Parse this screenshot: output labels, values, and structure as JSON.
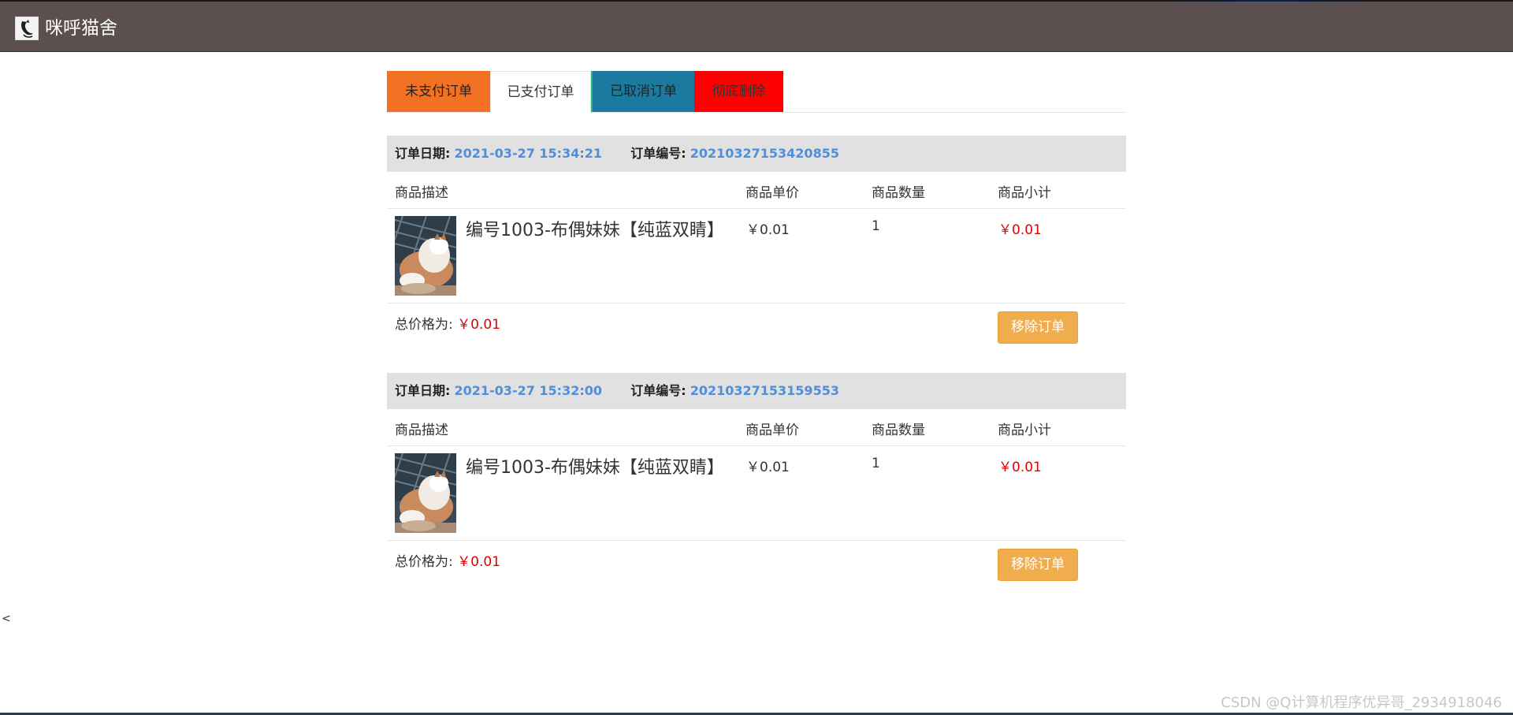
{
  "header": {
    "app_title": "咪呼猫舍",
    "logo_icon": "cat-logo-icon"
  },
  "tabs": [
    {
      "label": "未支付订单",
      "color": "#f37123"
    },
    {
      "label": "已支付订单",
      "color": "#ffffff",
      "active": true
    },
    {
      "label": "已取消订单",
      "color": "#1a7aa0"
    },
    {
      "label": "彻底删除",
      "color": "#ff0000"
    }
  ],
  "columns": {
    "desc": "商品描述",
    "unit_price": "商品单价",
    "quantity": "商品数量",
    "subtotal": "商品小计"
  },
  "labels": {
    "order_date": "订单日期:",
    "order_no": "订单编号:",
    "total": "总价格为:",
    "remove": "移除订单"
  },
  "orders": [
    {
      "date": "2021-03-27 15:34:21",
      "number": "20210327153420855",
      "item": {
        "name": "编号1003-布偶妹妹【纯蓝双睛】",
        "unit_price": "￥0.01",
        "quantity": "1",
        "subtotal": "￥0.01",
        "image": "cat-photo"
      },
      "total": "￥0.01"
    },
    {
      "date": "2021-03-27 15:32:00",
      "number": "20210327153159553",
      "item": {
        "name": "编号1003-布偶妹妹【纯蓝双睛】",
        "unit_price": "￥0.01",
        "quantity": "1",
        "subtotal": "￥0.01",
        "image": "cat-photo"
      },
      "total": "￥0.01"
    }
  ],
  "footer": {
    "back_symbol": "<",
    "watermark": "CSDN @Q计算机程序优异哥_2934918046"
  },
  "colors": {
    "header_bg": "#5b4f4f",
    "accent_blue": "#4f8fd9",
    "price_red": "#e00000",
    "button_orange": "#f0ad4e"
  }
}
